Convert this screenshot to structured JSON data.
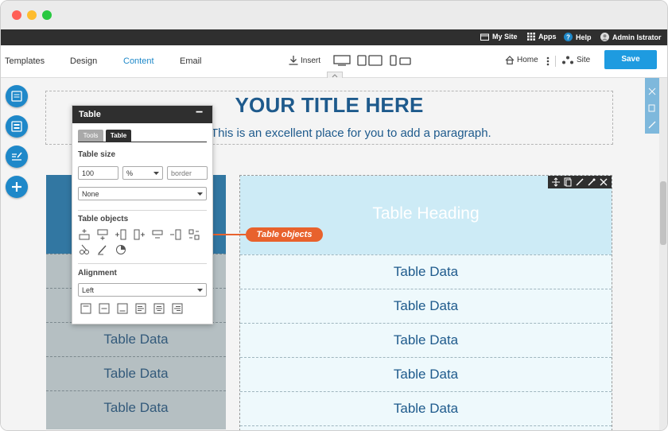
{
  "topbar": {
    "my_site": "My Site",
    "apps": "Apps",
    "help": "Help",
    "user": "Admin Istrator"
  },
  "nav": {
    "templates": "Templates",
    "design": "Design",
    "content": "Content",
    "email": "Email",
    "insert": "Insert",
    "home": "Home",
    "site": "Site",
    "save": "Save"
  },
  "page": {
    "title": "YOUR TITLE HERE",
    "paragraph": "nt here. This is an excellent place for you to add a paragraph."
  },
  "table_right": {
    "heading": "Table Heading",
    "rows": [
      "Table Data",
      "Table Data",
      "Table Data",
      "Table Data",
      "Table Data"
    ]
  },
  "table_left": {
    "rows": [
      "Table Data",
      "Table Data",
      "Table Data"
    ]
  },
  "panel": {
    "title": "Table",
    "close": "−",
    "tabs": [
      "Tools",
      "Table"
    ],
    "table_size_label": "Table size",
    "width_value": "100",
    "unit_value": "%",
    "border_placeholder": "border",
    "border_style_value": "None",
    "table_objects_label": "Table objects",
    "alignment_label": "Alignment",
    "alignment_value": "Left"
  },
  "callout": {
    "label": "Table objects"
  },
  "colors": {
    "accent": "#1e88c9",
    "callout": "#e8622d",
    "title": "#1e5a8c",
    "topbar": "#2f2f2f"
  }
}
